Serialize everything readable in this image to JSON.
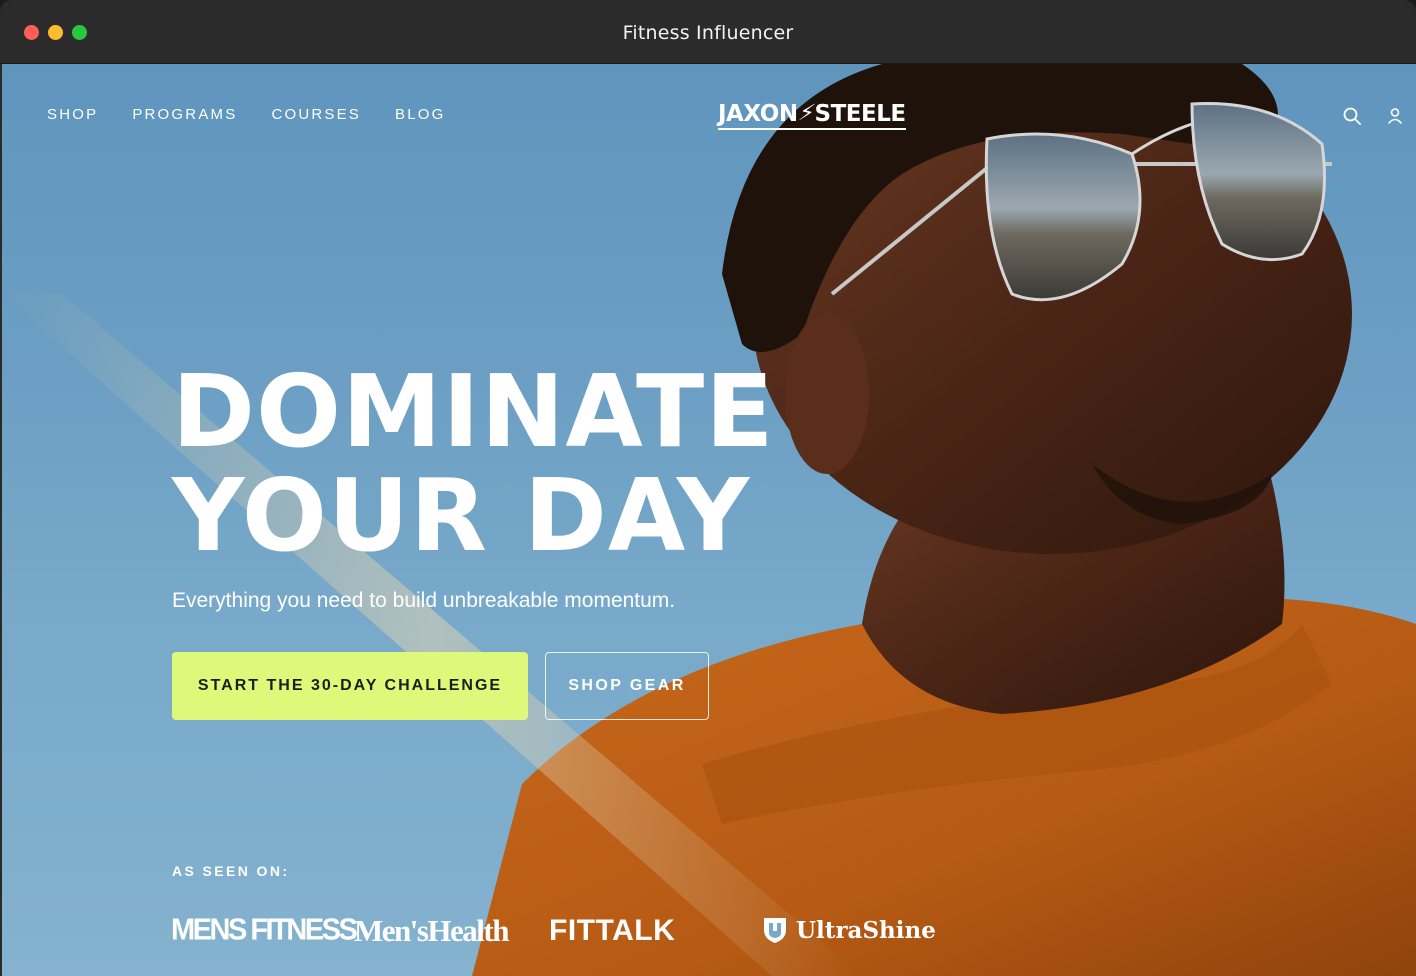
{
  "window": {
    "title": "Fitness Influencer"
  },
  "nav": {
    "links": [
      "SHOP",
      "PROGRAMS",
      "COURSES",
      "BLOG"
    ],
    "logo": {
      "left": "JAXON",
      "right": "STEELE"
    },
    "icons": [
      "search-icon",
      "account-icon"
    ]
  },
  "hero": {
    "title_line1": "DOMINATE",
    "title_line2": "YOUR DAY",
    "subtitle": "Everything you need to build unbreakable momentum.",
    "primary_cta": "START THE 30-DAY CHALLENGE",
    "secondary_cta": "SHOP GEAR"
  },
  "press": {
    "label": "AS SEEN ON:",
    "logos": [
      "MENS FITNESS",
      "Men'sHealth",
      "FITTALK",
      "UltraShine"
    ]
  },
  "colors": {
    "sky": "#6c9fc3",
    "accent": "#def97a",
    "shirt": "#c96a1e",
    "titlebar": "#2b2b2b"
  }
}
